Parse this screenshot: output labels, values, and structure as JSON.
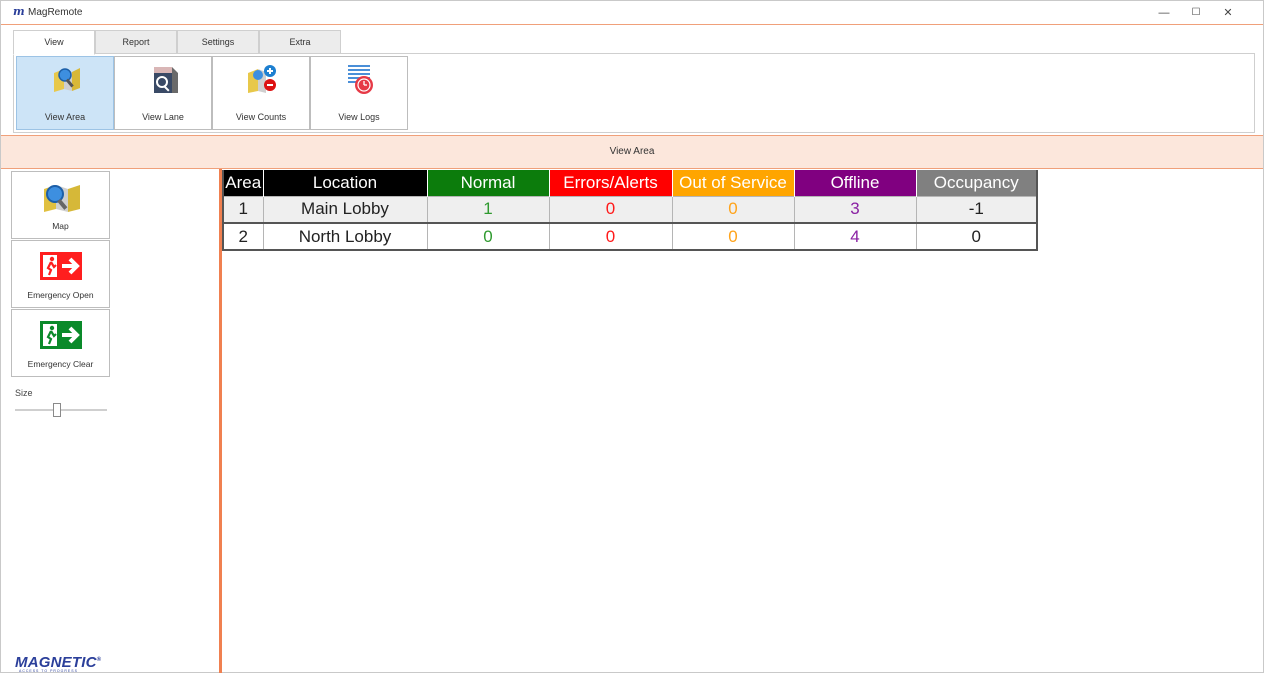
{
  "window": {
    "logo_glyph": "m",
    "title": "MagRemote",
    "min_glyph": "—",
    "max_glyph": "☐",
    "close_glyph": "✕"
  },
  "tabs": [
    {
      "label": "View",
      "active": true
    },
    {
      "label": "Report",
      "active": false
    },
    {
      "label": "Settings",
      "active": false
    },
    {
      "label": "Extra",
      "active": false
    }
  ],
  "ribbon": {
    "buttons": [
      {
        "label": "View Area",
        "icon": "view-area-icon",
        "active": true
      },
      {
        "label": "View Lane",
        "icon": "view-lane-icon",
        "active": false
      },
      {
        "label": "View Counts",
        "icon": "view-counts-icon",
        "active": false
      },
      {
        "label": "View Logs",
        "icon": "view-logs-icon",
        "active": false
      }
    ]
  },
  "section_title": "View Area",
  "left_panel": {
    "buttons": [
      {
        "label": "Map",
        "icon": "map-icon"
      },
      {
        "label": "Emergency Open",
        "icon": "emergency-exit-red-icon"
      },
      {
        "label": "Emergency Clear",
        "icon": "emergency-exit-green-icon"
      }
    ],
    "size_label": "Size",
    "size_value": 0.45,
    "brand": "MAGNETIC",
    "brand_mark": "®",
    "brand_tagline": "ACCESS TO PROGRESS"
  },
  "table": {
    "columns": [
      {
        "label": "Area",
        "color": "#000000"
      },
      {
        "label": "Location",
        "color": "#000000"
      },
      {
        "label": "Normal",
        "color": "#0c7c0c"
      },
      {
        "label": "Errors/Alerts",
        "color": "#ff0000"
      },
      {
        "label": "Out of Service",
        "color": "#ffa500"
      },
      {
        "label": "Offline",
        "color": "#800080"
      },
      {
        "label": "Occupancy",
        "color": "#808080"
      }
    ],
    "rows": [
      {
        "area": "1",
        "location": "Main Lobby",
        "normal": "1",
        "errors": "0",
        "oos": "0",
        "offline": "3",
        "occupancy": "-1"
      },
      {
        "area": "2",
        "location": "North Lobby",
        "normal": "0",
        "errors": "0",
        "oos": "0",
        "offline": "4",
        "occupancy": "0"
      }
    ]
  },
  "colors": {
    "accent": "#f08050",
    "header_band": "#fce7dc",
    "active_button": "#cde4f7",
    "brand": "#2b3f9a"
  }
}
